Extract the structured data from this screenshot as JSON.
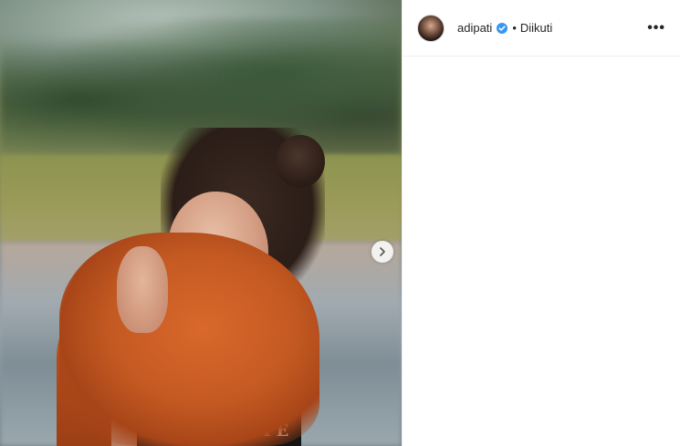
{
  "post": {
    "photo": {
      "shirt_print": "PE",
      "next_icon": "chevron-right-icon"
    },
    "header": {
      "username": "adipati",
      "verified_icon": "verified-badge-icon",
      "separator": "•",
      "follow_status": "Diikuti",
      "more_label": "•••"
    }
  },
  "colors": {
    "verified_blue": "#3897f0",
    "text": "#262626",
    "divider": "#efefef"
  }
}
